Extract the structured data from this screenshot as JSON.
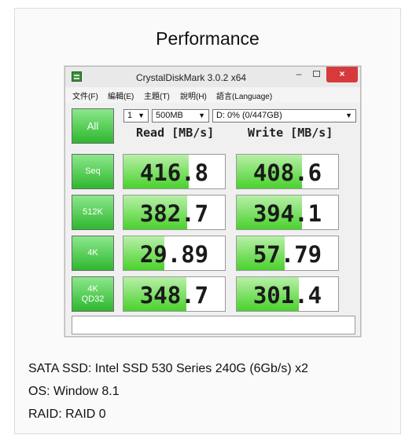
{
  "card": {
    "title": "Performance"
  },
  "window": {
    "title": "CrystalDiskMark 3.0.2 x64",
    "minimize": "–",
    "close": "×"
  },
  "menu": [
    "文件(F)",
    "編輯(E)",
    "主題(T)",
    "說明(H)",
    "語言(Language)"
  ],
  "controls": {
    "all_label": "All",
    "count": "1",
    "size": "500MB",
    "drive": "D: 0% (0/447GB)"
  },
  "headers": {
    "read": "Read [MB/s]",
    "write": "Write [MB/s]"
  },
  "rows": [
    {
      "label": "Seq",
      "read": "416.8",
      "write": "408.6",
      "read_fill": 0.64,
      "write_fill": 0.64
    },
    {
      "label": "512K",
      "read": "382.7",
      "write": "394.1",
      "read_fill": 0.63,
      "write_fill": 0.64
    },
    {
      "label": "4K",
      "read": "29.89",
      "write": "57.79",
      "read_fill": 0.4,
      "write_fill": 0.47
    },
    {
      "label": "4K\nQD32",
      "read": "348.7",
      "write": "301.4",
      "read_fill": 0.62,
      "write_fill": 0.61
    }
  ],
  "info": {
    "ssd": "SATA SSD: Intel SSD 530 Series 240G (6Gb/s) x2",
    "os": "OS: Window 8.1",
    "raid": "RAID: RAID 0"
  },
  "colors": {
    "button_green": "#2fb72f",
    "bar_green": "#4ad12d",
    "close_red": "#d73a3a"
  },
  "icons": {
    "app": "crystaldiskmark-icon"
  }
}
